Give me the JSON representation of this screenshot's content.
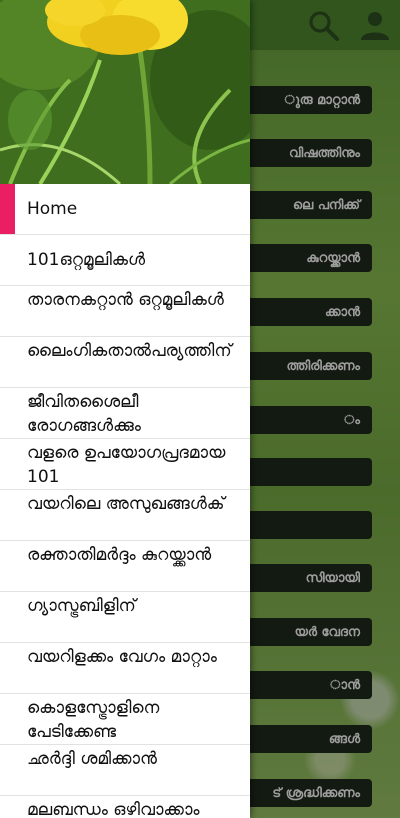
{
  "background_buttons": [
    "ുരു മാറ്റാൻ",
    "വിഷത്തിനും",
    "ലെ പനിക്ക്",
    "കുറയ്ക്കാൻ",
    "ക്കാൻ",
    "ത്തിരിക്കണം",
    "ം",
    "",
    "",
    "സിയായി",
    "യർ വേദന",
    "ാൻ",
    "ങ്ങൾ",
    "ട് ശ്രദ്ധിക്കണം"
  ],
  "menu": [
    {
      "label": "Home",
      "active": true
    },
    {
      "label": "101ഒറ്റമൂലികൾ"
    },
    {
      "label": "താരനകറ്റാൻ ഒറ്റമൂലികൾ"
    },
    {
      "label": "ലൈംഗികതാൽപര്യത്തിന്"
    },
    {
      "label": "ജീവിതശൈലീ രോഗങ്ങൾക്കും"
    },
    {
      "label": "വളരെ ഉപയോഗപ്രദമായ 101"
    },
    {
      "label": "വയറിലെ അസുഖങ്ങൾക്"
    },
    {
      "label": "രക്താതിമർദ്ദം കുറയ്ക്കാൻ"
    },
    {
      "label": "ഗ്യാസ്ട്രബിളിന്"
    },
    {
      "label": "വയറിളക്കം വേഗം മാറ്റാം"
    },
    {
      "label": "കൊളസ്ട്രോളിനെ പേടിക്കേണ്ട"
    },
    {
      "label": "ഛർദ്ദി ശമിക്കാൻ"
    },
    {
      "label": "മലബന്ധം ഒഴിവാക്കാം"
    }
  ],
  "icons": {
    "search": "search-icon",
    "profile": "profile-icon"
  }
}
